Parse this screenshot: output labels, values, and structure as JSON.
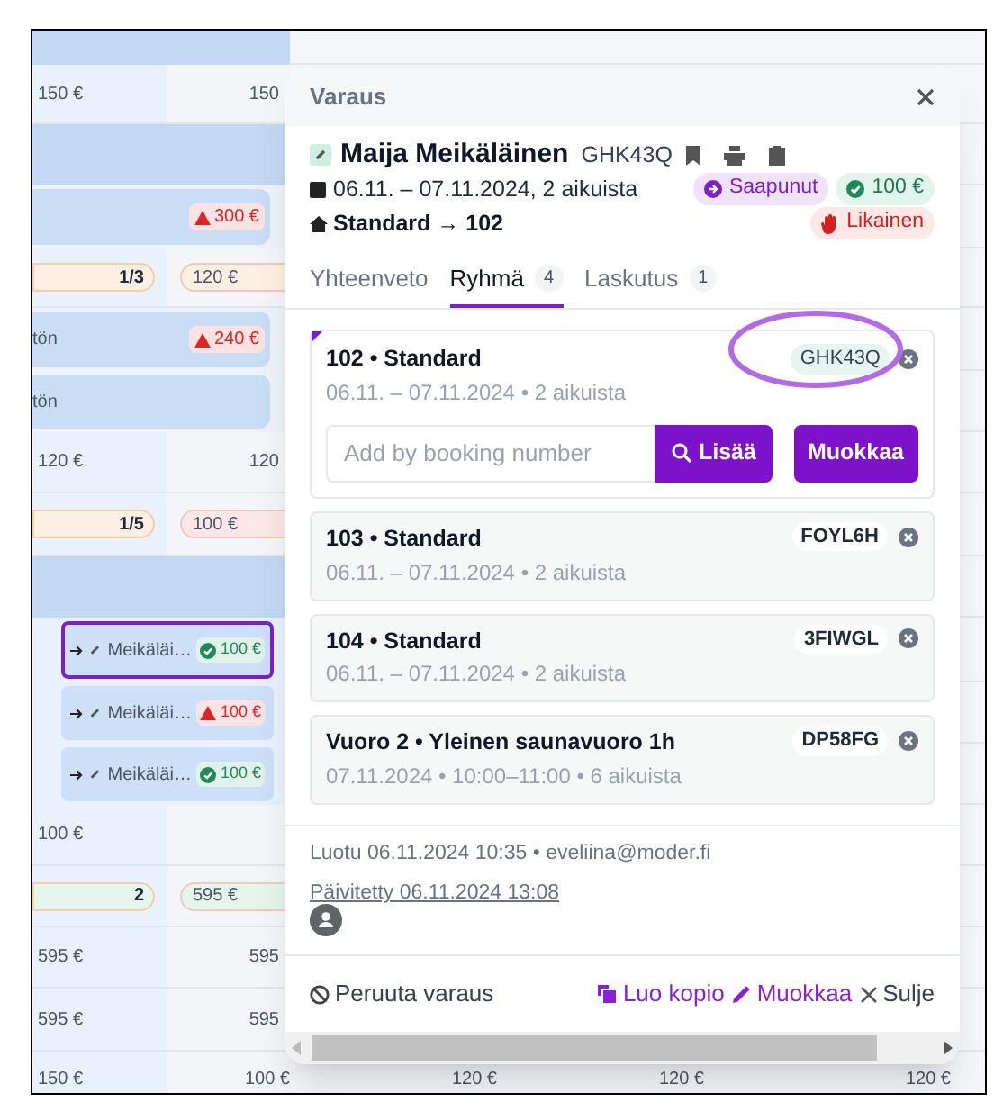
{
  "calendar": {
    "rows": [
      {
        "kind": "band"
      },
      {
        "kind": "prices",
        "cells": [
          "150 €",
          "150"
        ]
      },
      {
        "kind": "band"
      },
      {
        "kind": "bar",
        "badge": "300 €"
      },
      {
        "kind": "pills",
        "pills": [
          {
            "text": "1/3",
            "color": "#fdf0e2"
          },
          {
            "text": "120 €",
            "color": "#fdf0e2"
          }
        ]
      },
      {
        "kind": "bar",
        "text": "tön",
        "badge": "240 €"
      },
      {
        "kind": "bar",
        "text": "tön"
      },
      {
        "kind": "prices",
        "cells": [
          "120 €",
          "120"
        ]
      },
      {
        "kind": "pills",
        "pills": [
          {
            "text": "1/5",
            "color": "#fdf0e2"
          },
          {
            "text": "100 €",
            "color": "#fbe7e7"
          }
        ]
      },
      {
        "kind": "band"
      },
      {
        "kind": "chip",
        "name": "Meikäläi…",
        "amount": "100 €",
        "paid": true,
        "selected": true
      },
      {
        "kind": "chip",
        "name": "Meikäläi…",
        "amount": "100 €",
        "paid": false,
        "selected": false
      },
      {
        "kind": "chip",
        "name": "Meikäläi…",
        "amount": "100 €",
        "paid": true,
        "selected": false
      },
      {
        "kind": "prices",
        "cells": [
          "100 €"
        ]
      },
      {
        "kind": "pills",
        "pills": [
          {
            "text": "2",
            "color": "#e4f5ec"
          },
          {
            "text": "595 €",
            "color": "#e4f5ec"
          }
        ]
      },
      {
        "kind": "prices",
        "cells": [
          "595 €",
          "595"
        ]
      },
      {
        "kind": "prices",
        "cells": [
          "595 €",
          "595"
        ]
      },
      {
        "kind": "bottom",
        "cells": [
          "150 €",
          "100 €",
          "120 €",
          "120 €",
          "120 €"
        ]
      }
    ]
  },
  "dialog": {
    "title": "Varaus",
    "guest": {
      "name": "Maija Meikäläinen",
      "code": "GHK43Q"
    },
    "dates": "06.11. – 07.11.2024, 2 aikuista",
    "room": "Standard → 102",
    "badges": [
      {
        "kind": "status",
        "label": "Saapunut"
      },
      {
        "kind": "paid",
        "label": "100 €"
      },
      {
        "kind": "dirty",
        "label": "Likainen"
      }
    ],
    "tabs": [
      {
        "label": "Yhteenveto",
        "selected": false
      },
      {
        "label": "Ryhmä",
        "count": "4",
        "selected": true
      },
      {
        "label": "Laskutus",
        "count": "1",
        "selected": false
      }
    ],
    "group": [
      {
        "kind": "current",
        "title": "102 • Standard",
        "details": "06.11. – 07.11.2024 • 2 aikuista",
        "code": "GHK43Q"
      },
      {
        "kind": "member",
        "title": "103 • Standard",
        "details": "06.11. – 07.11.2024 • 2 aikuista",
        "code": "FOYL6H"
      },
      {
        "kind": "member",
        "title": "104 • Standard",
        "details": "06.11. – 07.11.2024 • 2 aikuista",
        "code": "3FIWGL"
      },
      {
        "kind": "member",
        "title": "Vuoro 2 • Yleinen saunavuoro 1h",
        "details": "07.11.2024 • 10:00–11:00 • 6 aikuista",
        "code": "DP58FG"
      }
    ],
    "add_field": {
      "placeholder": "Add by booking number"
    },
    "add_button": "Lisää",
    "edit_button": "Muokkaa",
    "created": "Luotu 06.11.2024 10:35 • eveliina@moder.fi",
    "updated": "Päivitetty 06.11.2024 13:08",
    "footer": {
      "cancel": "Peruuta varaus",
      "copy": "Luo kopio",
      "edit": "Muokkaa",
      "close": "Sulje"
    }
  }
}
